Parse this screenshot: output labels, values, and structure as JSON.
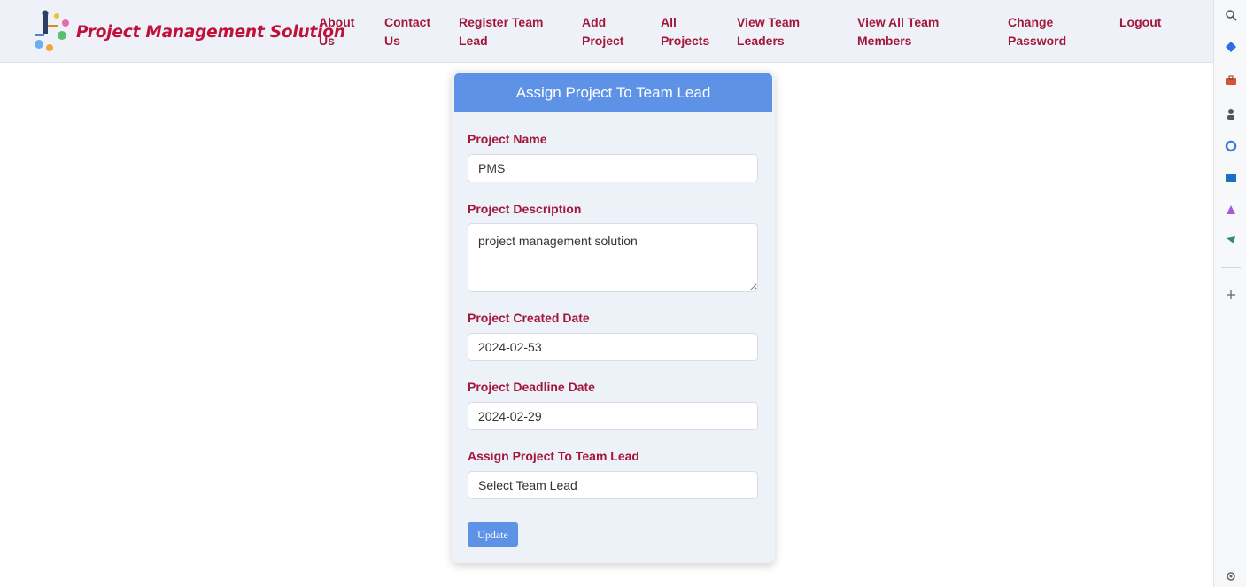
{
  "brand": {
    "title": "Project Management Solution"
  },
  "nav": [
    {
      "label": "About\nUs"
    },
    {
      "label": "Contact\nUs"
    },
    {
      "label": "Register Team\nLead"
    },
    {
      "label": "Add\nProject"
    },
    {
      "label": "All\nProjects"
    },
    {
      "label": "View Team\nLeaders"
    },
    {
      "label": "View All Team\nMembers"
    },
    {
      "label": "Change\nPassword"
    },
    {
      "label": "Logout"
    }
  ],
  "form": {
    "title": "Assign Project To Team Lead",
    "project_name": {
      "label": "Project Name",
      "value": "PMS"
    },
    "project_description": {
      "label": "Project Description",
      "value": "project management solution"
    },
    "created_date": {
      "label": "Project Created Date",
      "value": "2024-02-53"
    },
    "deadline_date": {
      "label": "Project Deadline Date",
      "value": "2024-02-29"
    },
    "team_lead": {
      "label": "Assign Project To Team Lead",
      "selected": "Select Team Lead"
    },
    "submit_label": "Update"
  },
  "colors": {
    "accent": "#5d92e6",
    "brand": "#c0113c",
    "label": "#a3173c",
    "card_bg": "#edf1f8"
  }
}
